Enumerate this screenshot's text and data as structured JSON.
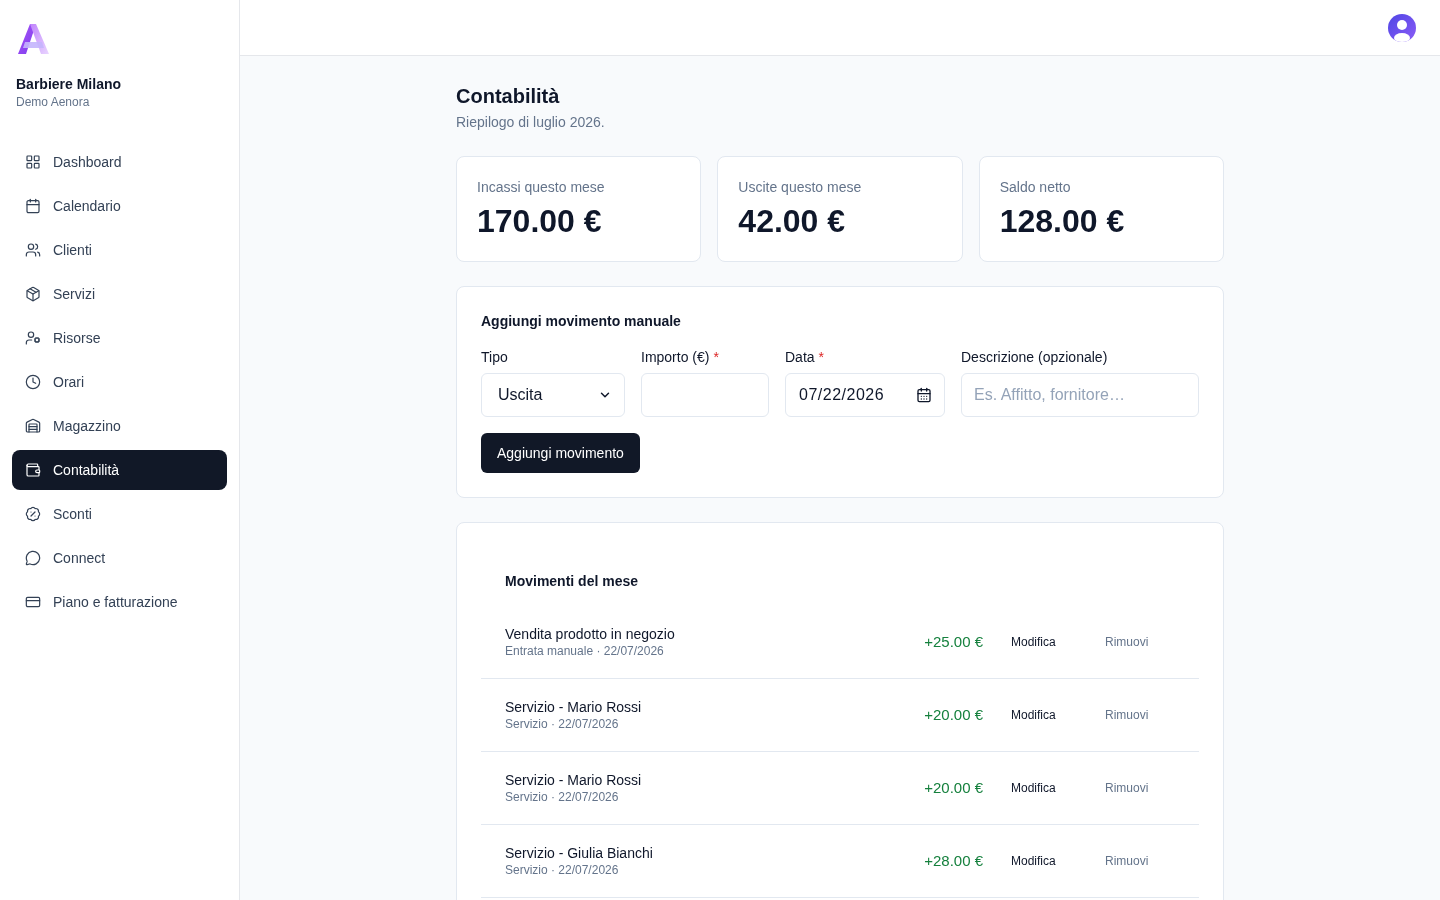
{
  "sidebar": {
    "brand": {
      "name": "Barbiere Milano",
      "subtitle": "Demo Aenora"
    },
    "items": [
      {
        "label": "Dashboard",
        "selected": false
      },
      {
        "label": "Calendario",
        "selected": false
      },
      {
        "label": "Clienti",
        "selected": false
      },
      {
        "label": "Servizi",
        "selected": false
      },
      {
        "label": "Risorse",
        "selected": false
      },
      {
        "label": "Orari",
        "selected": false
      },
      {
        "label": "Magazzino",
        "selected": false
      },
      {
        "label": "Contabilità",
        "selected": true
      },
      {
        "label": "Sconti",
        "selected": false
      },
      {
        "label": "Connect",
        "selected": false
      },
      {
        "label": "Piano e fatturazione",
        "selected": false
      }
    ]
  },
  "page": {
    "title": "Contabilità",
    "subtitle": "Riepilogo di luglio 2026."
  },
  "stats": [
    {
      "label": "Incassi questo mese",
      "value": "170.00 €"
    },
    {
      "label": "Uscite questo mese",
      "value": "42.00 €"
    },
    {
      "label": "Saldo netto",
      "value": "128.00 €"
    }
  ],
  "manual_entry": {
    "title": "Aggiungi movimento manuale",
    "fields": [
      {
        "kind": "select",
        "label": "Tipo",
        "value": "Uscita"
      },
      {
        "kind": "number",
        "label": "Importo (€)",
        "required_mark": "*"
      },
      {
        "kind": "date",
        "label": "Data",
        "required_mark": "*",
        "value": "07/22/2026"
      },
      {
        "kind": "text",
        "label": "Descrizione (opzionale)",
        "placeholder": "Es. Affitto, fornitore…"
      }
    ],
    "submit": "Aggiungi movimento"
  },
  "movements": {
    "title": "Movimenti del mese",
    "rows": [
      {
        "title": "Vendita prodotto in negozio",
        "meta": "Entrata manuale · 22/07/2026",
        "amount": "+25.00 €",
        "edit": "Modifica",
        "remove": "Rimuovi"
      },
      {
        "title": "Servizio - Mario Rossi",
        "meta": "Servizio · 22/07/2026",
        "amount": "+20.00 €",
        "edit": "Modifica",
        "remove": "Rimuovi"
      },
      {
        "title": "Servizio - Mario Rossi",
        "meta": "Servizio · 22/07/2026",
        "amount": "+20.00 €",
        "edit": "Modifica",
        "remove": "Rimuovi"
      },
      {
        "title": "Servizio - Giulia Bianchi",
        "meta": "Servizio · 22/07/2026",
        "amount": "+28.00 €",
        "edit": "Modifica",
        "remove": "Rimuovi"
      }
    ]
  }
}
